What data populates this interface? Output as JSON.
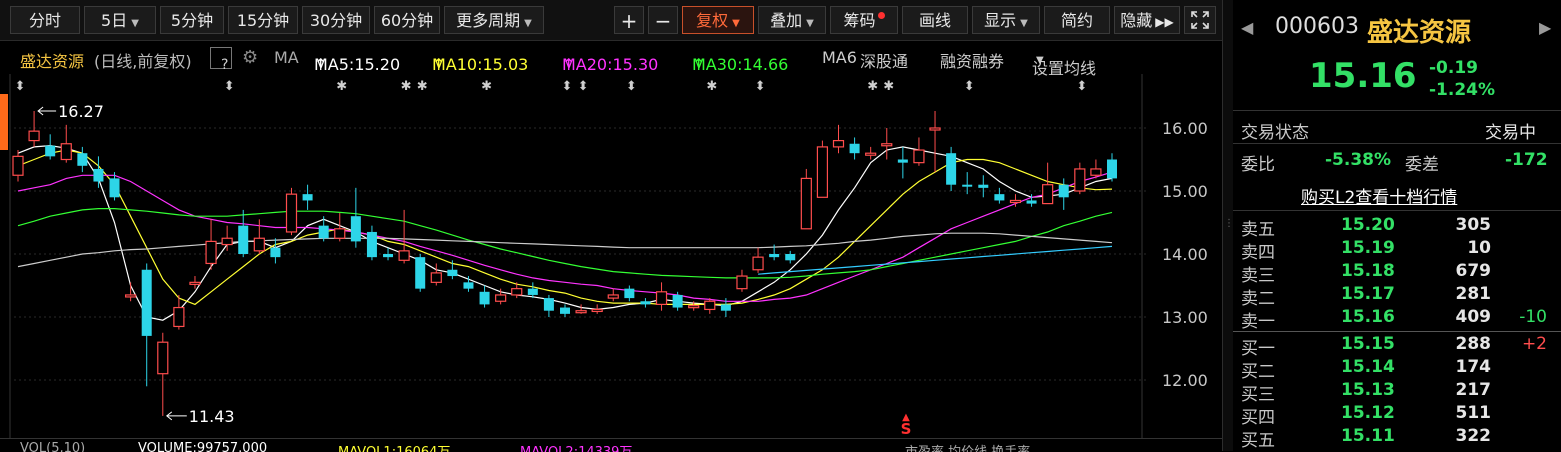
{
  "toolbar": {
    "buttons": [
      "分时",
      "5日",
      "5分钟",
      "15分钟",
      "30分钟",
      "60分钟",
      "更多周期"
    ],
    "plus": "+",
    "minus": "−",
    "fuquan": "复权",
    "overlay": "叠加",
    "chips": "筹码",
    "draw": "画线",
    "display": "显示",
    "simple": "简约",
    "hide": "隐藏",
    "expand_icon": "expand-icon"
  },
  "ma_bar": {
    "name": "盛达资源",
    "mode": "(日线,前复权)",
    "help": "?",
    "ma_label": "MA",
    "ma5": "MA5:15.20",
    "ma10": "MA10:15.03",
    "ma20": "MA20:15.30",
    "ma30": "MA30:14.66",
    "ma6": "MA6",
    "szt": "深股通",
    "margin": "融资融券",
    "set_ma": "设置均线",
    "colors": {
      "ma5": "#ffffff",
      "ma10": "#ffff33",
      "ma20": "#ff33ff",
      "ma30": "#33ff33",
      "ma6": "#cccccc"
    }
  },
  "volume_bar": {
    "vol": "VOL(5,10)",
    "volume": "VOLUME:99757.000",
    "mavol1": "MAVOL1:16064万",
    "mavol2": "MAVOL2:14339万",
    "tabs": "市盈率  均价线  换手率"
  },
  "chart_data": {
    "type": "candlestick",
    "y_ticks": [
      "16.00",
      "15.00",
      "14.00",
      "13.00",
      "12.00"
    ],
    "ylim": [
      11.2,
      16.8
    ],
    "max_label": "16.27",
    "min_label": "11.43",
    "signal": "S",
    "candles": [
      {
        "o": 15.25,
        "c": 15.55,
        "h": 15.65,
        "l": 15.15
      },
      {
        "o": 15.8,
        "c": 15.95,
        "h": 16.27,
        "l": 15.7
      },
      {
        "o": 15.72,
        "c": 15.55,
        "h": 15.9,
        "l": 15.5
      },
      {
        "o": 15.5,
        "c": 15.75,
        "h": 16.05,
        "l": 15.45
      },
      {
        "o": 15.6,
        "c": 15.4,
        "h": 15.7,
        "l": 15.3
      },
      {
        "o": 15.35,
        "c": 15.15,
        "h": 15.55,
        "l": 15.05
      },
      {
        "o": 15.2,
        "c": 14.9,
        "h": 15.3,
        "l": 14.85
      },
      {
        "o": 13.35,
        "c": 13.35,
        "h": 13.55,
        "l": 13.25
      },
      {
        "o": 13.75,
        "c": 12.7,
        "h": 13.85,
        "l": 11.9
      },
      {
        "o": 12.1,
        "c": 12.6,
        "h": 12.75,
        "l": 11.43
      },
      {
        "o": 12.85,
        "c": 13.15,
        "h": 13.35,
        "l": 12.8
      },
      {
        "o": 13.55,
        "c": 13.55,
        "h": 13.65,
        "l": 13.45
      },
      {
        "o": 13.85,
        "c": 14.2,
        "h": 14.55,
        "l": 13.75
      },
      {
        "o": 14.15,
        "c": 14.25,
        "h": 14.45,
        "l": 14.05
      },
      {
        "o": 14.45,
        "c": 14.0,
        "h": 14.7,
        "l": 13.95
      },
      {
        "o": 14.05,
        "c": 14.25,
        "h": 14.55,
        "l": 14.0
      },
      {
        "o": 14.1,
        "c": 13.95,
        "h": 14.25,
        "l": 13.85
      },
      {
        "o": 14.35,
        "c": 14.95,
        "h": 15.05,
        "l": 14.3
      },
      {
        "o": 14.95,
        "c": 14.85,
        "h": 15.1,
        "l": 14.7
      },
      {
        "o": 14.45,
        "c": 14.25,
        "h": 14.6,
        "l": 14.2
      },
      {
        "o": 14.25,
        "c": 14.4,
        "h": 14.65,
        "l": 14.2
      },
      {
        "o": 14.6,
        "c": 14.2,
        "h": 15.05,
        "l": 14.1
      },
      {
        "o": 14.35,
        "c": 13.95,
        "h": 14.45,
        "l": 13.9
      },
      {
        "o": 14.0,
        "c": 13.95,
        "h": 14.1,
        "l": 13.9
      },
      {
        "o": 13.9,
        "c": 14.05,
        "h": 14.7,
        "l": 13.85
      },
      {
        "o": 13.95,
        "c": 13.45,
        "h": 14.0,
        "l": 13.4
      },
      {
        "o": 13.55,
        "c": 13.7,
        "h": 13.85,
        "l": 13.5
      },
      {
        "o": 13.75,
        "c": 13.65,
        "h": 13.9,
        "l": 13.6
      },
      {
        "o": 13.55,
        "c": 13.45,
        "h": 13.65,
        "l": 13.4
      },
      {
        "o": 13.4,
        "c": 13.2,
        "h": 13.5,
        "l": 13.15
      },
      {
        "o": 13.25,
        "c": 13.35,
        "h": 13.45,
        "l": 13.2
      },
      {
        "o": 13.35,
        "c": 13.45,
        "h": 13.55,
        "l": 13.3
      },
      {
        "o": 13.45,
        "c": 13.35,
        "h": 13.55,
        "l": 13.3
      },
      {
        "o": 13.3,
        "c": 13.1,
        "h": 13.35,
        "l": 13.0
      },
      {
        "o": 13.15,
        "c": 13.05,
        "h": 13.2,
        "l": 13.0
      },
      {
        "o": 13.1,
        "c": 13.1,
        "h": 13.2,
        "l": 13.05
      },
      {
        "o": 13.12,
        "c": 13.12,
        "h": 13.2,
        "l": 13.05
      },
      {
        "o": 13.3,
        "c": 13.35,
        "h": 13.45,
        "l": 13.25
      },
      {
        "o": 13.45,
        "c": 13.3,
        "h": 13.5,
        "l": 13.25
      },
      {
        "o": 13.25,
        "c": 13.2,
        "h": 13.3,
        "l": 13.15
      },
      {
        "o": 13.2,
        "c": 13.4,
        "h": 13.55,
        "l": 13.1
      },
      {
        "o": 13.35,
        "c": 13.15,
        "h": 13.4,
        "l": 13.1
      },
      {
        "o": 13.18,
        "c": 13.18,
        "h": 13.25,
        "l": 13.1
      },
      {
        "o": 13.12,
        "c": 13.25,
        "h": 13.3,
        "l": 13.05
      },
      {
        "o": 13.2,
        "c": 13.1,
        "h": 13.3,
        "l": 13.0
      },
      {
        "o": 13.45,
        "c": 13.65,
        "h": 13.75,
        "l": 13.4
      },
      {
        "o": 13.75,
        "c": 13.95,
        "h": 14.1,
        "l": 13.7
      },
      {
        "o": 14.0,
        "c": 13.95,
        "h": 14.15,
        "l": 13.9
      },
      {
        "o": 14.0,
        "c": 13.9,
        "h": 14.05,
        "l": 13.85
      },
      {
        "o": 14.4,
        "c": 15.2,
        "h": 15.35,
        "l": 14.4
      },
      {
        "o": 14.9,
        "c": 15.7,
        "h": 15.8,
        "l": 14.9
      },
      {
        "o": 15.7,
        "c": 15.8,
        "h": 16.05,
        "l": 15.6
      },
      {
        "o": 15.75,
        "c": 15.6,
        "h": 15.85,
        "l": 15.5
      },
      {
        "o": 15.6,
        "c": 15.6,
        "h": 15.7,
        "l": 15.5
      },
      {
        "o": 15.75,
        "c": 15.75,
        "h": 16.0,
        "l": 15.5
      },
      {
        "o": 15.5,
        "c": 15.45,
        "h": 15.7,
        "l": 15.2
      },
      {
        "o": 15.45,
        "c": 15.65,
        "h": 15.85,
        "l": 15.4
      },
      {
        "o": 16.0,
        "c": 16.0,
        "h": 16.27,
        "l": 15.3
      },
      {
        "o": 15.6,
        "c": 15.1,
        "h": 15.7,
        "l": 15.0
      },
      {
        "o": 15.1,
        "c": 15.08,
        "h": 15.3,
        "l": 14.95
      },
      {
        "o": 15.1,
        "c": 15.05,
        "h": 15.25,
        "l": 14.9
      },
      {
        "o": 14.95,
        "c": 14.85,
        "h": 15.05,
        "l": 14.8
      },
      {
        "o": 14.85,
        "c": 14.85,
        "h": 14.95,
        "l": 14.75
      },
      {
        "o": 14.85,
        "c": 14.8,
        "h": 14.95,
        "l": 14.75
      },
      {
        "o": 14.8,
        "c": 15.1,
        "h": 15.45,
        "l": 14.8
      },
      {
        "o": 15.1,
        "c": 14.9,
        "h": 15.2,
        "l": 14.7
      },
      {
        "o": 15.0,
        "c": 15.35,
        "h": 15.45,
        "l": 14.95
      },
      {
        "o": 15.25,
        "c": 15.35,
        "h": 15.5,
        "l": 15.2
      },
      {
        "o": 15.5,
        "c": 15.2,
        "h": 15.6,
        "l": 15.15
      }
    ],
    "ma_lines": [
      {
        "name": "MA5",
        "color": "#ffffff",
        "values": [
          15.6,
          15.7,
          15.72,
          15.68,
          15.6,
          15.2,
          14.5,
          13.5,
          13.0,
          12.95,
          13.1,
          13.4,
          13.8,
          14.15,
          14.2,
          14.2,
          14.1,
          14.2,
          14.45,
          14.55,
          14.45,
          14.35,
          14.2,
          14.1,
          14.0,
          13.9,
          13.75,
          13.7,
          13.6,
          13.5,
          13.4,
          13.35,
          13.32,
          13.28,
          13.22,
          13.15,
          13.12,
          13.15,
          13.2,
          13.22,
          13.28,
          13.25,
          13.22,
          13.2,
          13.18,
          13.25,
          13.4,
          13.55,
          13.75,
          14.0,
          14.3,
          14.7,
          15.05,
          15.45,
          15.65,
          15.7,
          15.65,
          15.6,
          15.55,
          15.45,
          15.35,
          15.15,
          15.0,
          14.9,
          14.92,
          14.95,
          15.05,
          15.15,
          15.2
        ]
      },
      {
        "name": "MA10",
        "color": "#ffff33",
        "values": [
          15.4,
          15.5,
          15.6,
          15.65,
          15.6,
          15.4,
          15.1,
          14.6,
          14.1,
          13.6,
          13.3,
          13.2,
          13.4,
          13.6,
          13.8,
          14.0,
          14.15,
          14.2,
          14.3,
          14.35,
          14.4,
          14.35,
          14.3,
          14.2,
          14.15,
          14.05,
          13.95,
          13.85,
          13.8,
          13.7,
          13.6,
          13.52,
          13.48,
          13.42,
          13.38,
          13.3,
          13.25,
          13.22,
          13.22,
          13.22,
          13.2,
          13.2,
          13.2,
          13.2,
          13.2,
          13.22,
          13.28,
          13.35,
          13.45,
          13.6,
          13.75,
          13.95,
          14.2,
          14.45,
          14.7,
          14.95,
          15.15,
          15.3,
          15.45,
          15.5,
          15.5,
          15.45,
          15.35,
          15.25,
          15.15,
          15.1,
          15.05,
          15.02,
          15.03
        ]
      },
      {
        "name": "MA20",
        "color": "#ff33ff",
        "values": [
          15.0,
          15.05,
          15.1,
          15.2,
          15.25,
          15.25,
          15.25,
          15.15,
          15.0,
          14.85,
          14.7,
          14.6,
          14.55,
          14.5,
          14.48,
          14.45,
          14.42,
          14.42,
          14.42,
          14.4,
          14.38,
          14.35,
          14.3,
          14.25,
          14.2,
          14.12,
          14.05,
          13.98,
          13.9,
          13.82,
          13.75,
          13.68,
          13.62,
          13.58,
          13.55,
          13.52,
          13.5,
          13.45,
          13.42,
          13.4,
          13.38,
          13.35,
          13.3,
          13.28,
          13.25,
          13.25,
          13.25,
          13.28,
          13.3,
          13.35,
          13.45,
          13.55,
          13.65,
          13.75,
          13.85,
          13.95,
          14.1,
          14.25,
          14.4,
          14.5,
          14.6,
          14.7,
          14.8,
          14.9,
          14.95,
          15.05,
          15.15,
          15.22,
          15.3
        ]
      },
      {
        "name": "MA30",
        "color": "#33ff33",
        "values": [
          14.45,
          14.52,
          14.6,
          14.65,
          14.7,
          14.72,
          14.72,
          14.7,
          14.68,
          14.65,
          14.62,
          14.6,
          14.6,
          14.6,
          14.62,
          14.64,
          14.66,
          14.68,
          14.68,
          14.68,
          14.66,
          14.64,
          14.6,
          14.56,
          14.52,
          14.45,
          14.38,
          14.3,
          14.22,
          14.15,
          14.08,
          14.02,
          13.96,
          13.9,
          13.85,
          13.8,
          13.76,
          13.72,
          13.7,
          13.68,
          13.66,
          13.65,
          13.64,
          13.63,
          13.62,
          13.62,
          13.62,
          13.62,
          13.63,
          13.65,
          13.68,
          13.7,
          13.72,
          13.75,
          13.8,
          13.85,
          13.9,
          13.95,
          14.0,
          14.05,
          14.1,
          14.15,
          14.2,
          14.28,
          14.35,
          14.45,
          14.52,
          14.6,
          14.66
        ]
      },
      {
        "name": "MA6",
        "color": "#cccccc",
        "values": [
          13.8,
          13.85,
          13.9,
          13.95,
          14.0,
          14.02,
          14.05,
          14.07,
          14.08,
          14.1,
          14.12,
          14.14,
          14.16,
          14.18,
          14.2,
          14.21,
          14.22,
          14.23,
          14.24,
          14.25,
          14.25,
          14.25,
          14.25,
          14.25,
          14.24,
          14.23,
          14.22,
          14.21,
          14.2,
          14.19,
          14.18,
          14.17,
          14.16,
          14.15,
          14.14,
          14.13,
          14.12,
          14.11,
          14.1,
          14.1,
          14.1,
          14.1,
          14.1,
          14.1,
          14.1,
          14.1,
          14.1,
          14.11,
          14.12,
          14.13,
          14.15,
          14.17,
          14.2,
          14.22,
          14.25,
          14.28,
          14.3,
          14.32,
          14.33,
          14.33,
          14.33,
          14.32,
          14.3,
          14.28,
          14.26,
          14.24,
          14.22,
          14.2,
          14.18
        ]
      },
      {
        "name": "",
        "color": "#33ccff",
        "values": [
          null,
          null,
          null,
          null,
          null,
          null,
          null,
          null,
          null,
          null,
          null,
          null,
          null,
          null,
          null,
          null,
          null,
          null,
          null,
          null,
          null,
          null,
          null,
          null,
          null,
          null,
          null,
          null,
          null,
          null,
          null,
          null,
          null,
          null,
          null,
          null,
          null,
          null,
          null,
          null,
          null,
          null,
          null,
          null,
          null,
          null,
          13.68,
          13.7,
          13.72,
          13.74,
          13.76,
          13.78,
          13.8,
          13.82,
          13.84,
          13.86,
          13.88,
          13.9,
          13.92,
          13.94,
          13.96,
          13.98,
          14.0,
          14.02,
          14.04,
          14.06,
          14.08,
          14.1,
          14.12
        ]
      }
    ]
  },
  "panel": {
    "code": "000603",
    "name": "盛达资源",
    "price": "15.16",
    "change": "-0.19",
    "change_pct": "-1.24%",
    "status_label": "交易状态",
    "status_value": "交易中",
    "weibi_label": "委比",
    "weibi_value": "-5.38%",
    "weicha_label": "委差",
    "weicha_value": "-172",
    "l2_link": "购买L2查看十档行情",
    "asks": [
      {
        "label": "卖五",
        "price": "15.20",
        "vol": "305",
        "delta": ""
      },
      {
        "label": "卖四",
        "price": "15.19",
        "vol": "10",
        "delta": ""
      },
      {
        "label": "卖三",
        "price": "15.18",
        "vol": "679",
        "delta": ""
      },
      {
        "label": "卖二",
        "price": "15.17",
        "vol": "281",
        "delta": ""
      },
      {
        "label": "卖一",
        "price": "15.16",
        "vol": "409",
        "delta": "-10"
      }
    ],
    "bids": [
      {
        "label": "买一",
        "price": "15.15",
        "vol": "288",
        "delta": "+2"
      },
      {
        "label": "买二",
        "price": "15.14",
        "vol": "174",
        "delta": ""
      },
      {
        "label": "买三",
        "price": "15.13",
        "vol": "217",
        "delta": ""
      },
      {
        "label": "买四",
        "price": "15.12",
        "vol": "511",
        "delta": ""
      },
      {
        "label": "买五",
        "price": "15.11",
        "vol": "322",
        "delta": ""
      }
    ]
  }
}
